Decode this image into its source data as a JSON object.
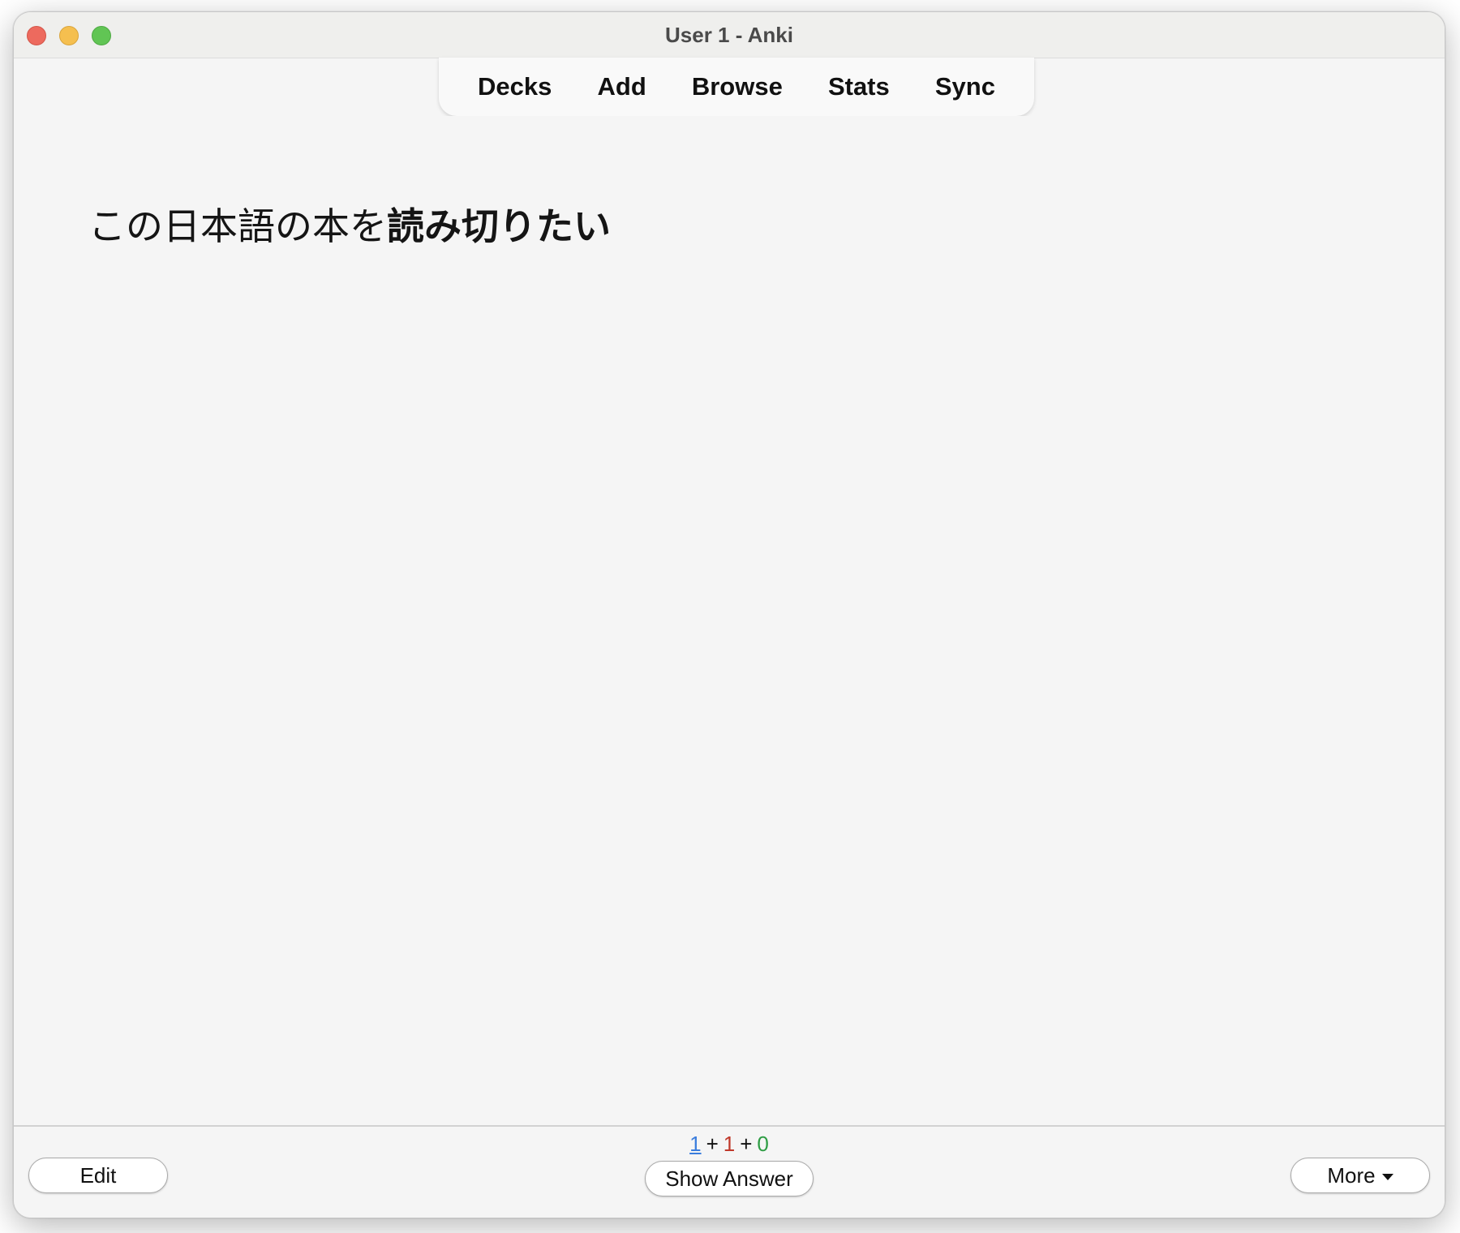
{
  "window": {
    "title": "User 1 - Anki"
  },
  "toolbar": {
    "items": [
      {
        "label": "Decks"
      },
      {
        "label": "Add"
      },
      {
        "label": "Browse"
      },
      {
        "label": "Stats"
      },
      {
        "label": "Sync"
      }
    ]
  },
  "card": {
    "front_plain": "この日本語の本を",
    "front_bold": "読み切りたい"
  },
  "bottom": {
    "edit_label": "Edit",
    "show_answer_label": "Show Answer",
    "more_label": "More",
    "counts": {
      "new": "1",
      "learning": "1",
      "review": "0",
      "separator": "+"
    }
  },
  "colors": {
    "new_count": "#3b7ddd",
    "learning_count": "#c0392b",
    "review_count": "#2e9d44",
    "close_button": "#ed6a5e",
    "minimize_button": "#f5bf4f",
    "zoom_button": "#61c554"
  },
  "icons": {
    "close": "close-icon",
    "minimize": "minimize-icon",
    "zoom": "zoom-icon",
    "more_caret": "caret-down-icon"
  }
}
